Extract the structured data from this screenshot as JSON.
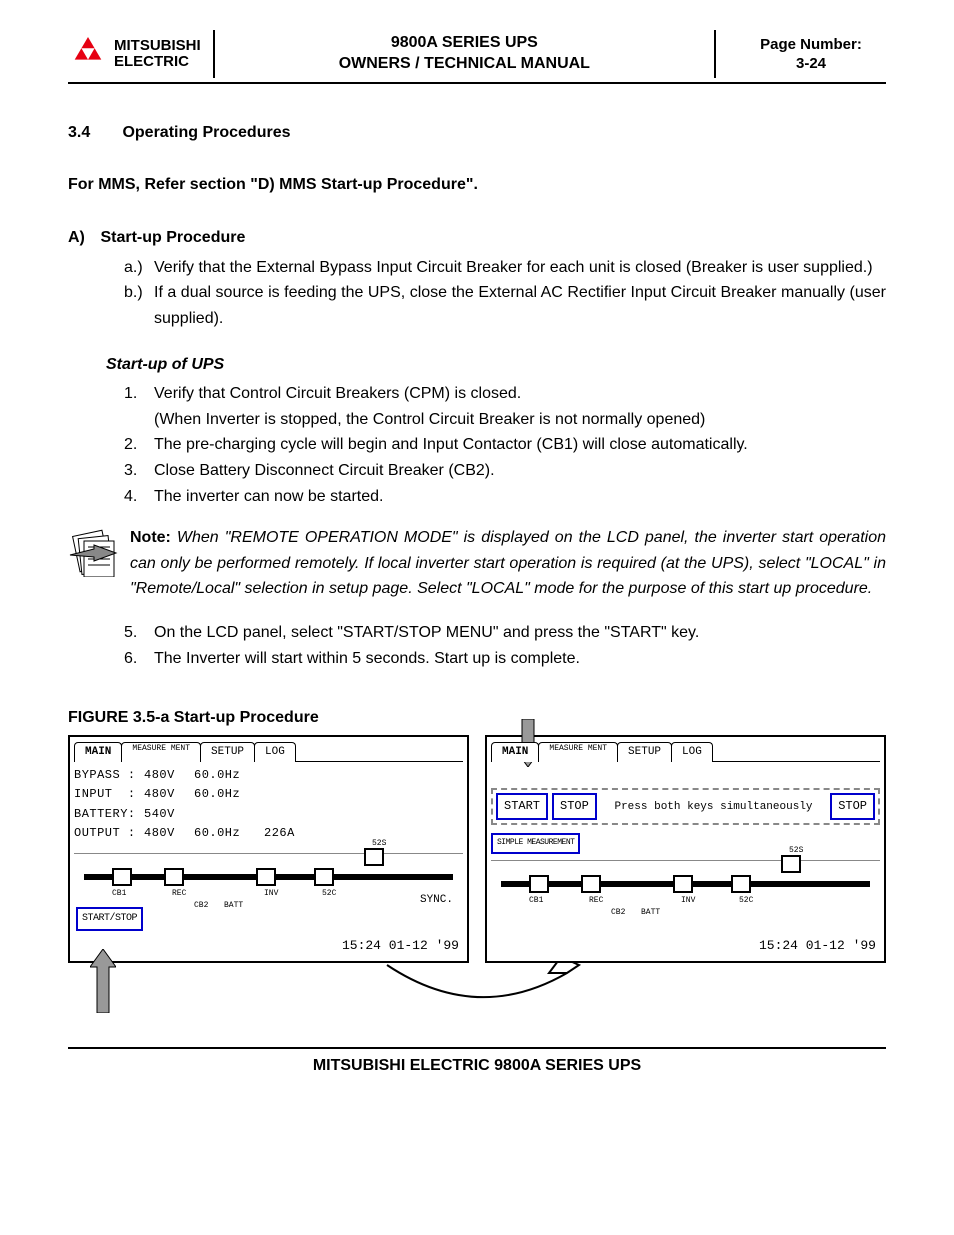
{
  "header": {
    "brand1": "MITSUBISHI",
    "brand2": "ELECTRIC",
    "title1": "9800A SERIES UPS",
    "title2": "OWNERS / TECHNICAL MANUAL",
    "page_label": "Page Number:",
    "page_num": "3-24"
  },
  "section": {
    "num": "3.4",
    "title": "Operating Procedures",
    "mms_ref": "For MMS, Refer section \"D) MMS Start-up Procedure\"."
  },
  "A": {
    "letter": "A)",
    "title": "Start-up Procedure",
    "items": [
      {
        "label": "a.)",
        "text": "Verify that the External Bypass Input Circuit Breaker for each unit is closed (Breaker is user supplied.)"
      },
      {
        "label": "b.)",
        "text": "If a dual source is feeding the UPS, close the External AC Rectifier Input Circuit Breaker manually (user supplied)."
      }
    ]
  },
  "startup": {
    "title": "Start-up of UPS",
    "items1": [
      {
        "label": "1.",
        "text": "Verify that Control Circuit Breakers (CPM) is closed."
      },
      {
        "label": "",
        "text": "(When Inverter is stopped, the Control Circuit Breaker is not normally opened)"
      },
      {
        "label": "2.",
        "text": "The pre-charging cycle will begin and Input Contactor (CB1) will close automatically."
      },
      {
        "label": "3.",
        "text": "Close Battery Disconnect Circuit Breaker (CB2)."
      },
      {
        "label": "4.",
        "text": "The inverter can now be started."
      }
    ],
    "items2": [
      {
        "label": "5.",
        "text": "On the LCD panel, select \"START/STOP MENU\" and press the \"START\" key."
      },
      {
        "label": "6.",
        "text": "The Inverter will start within 5 seconds. Start up is complete."
      }
    ]
  },
  "note": {
    "label": "Note:",
    "text": "When \"REMOTE OPERATION MODE\" is displayed on the LCD panel, the inverter start operation can only be performed remotely. If local inverter start operation is required (at the UPS), select \"LOCAL\" in \"Remote/Local\" selection in setup page. Select \"LOCAL\" mode for the purpose of this start up procedure."
  },
  "figure": {
    "title": "FIGURE 3.5-a   Start-up Procedure"
  },
  "lcd_tabs": [
    "MAIN",
    "MEASURE MENT",
    "SETUP",
    "LOG"
  ],
  "lcd1": {
    "rows": [
      [
        "BYPASS :",
        "480V",
        "60.0Hz",
        ""
      ],
      [
        "INPUT  :",
        "480V",
        "60.0Hz",
        ""
      ],
      [
        "BATTERY:",
        "540V",
        "",
        ""
      ],
      [
        "OUTPUT :",
        "480V",
        "60.0Hz",
        "226A"
      ]
    ],
    "ss_btn": "START/STOP",
    "sync": "SYNC.",
    "diag_labels": {
      "cb1": "CB1",
      "rec": "REC",
      "inv": "INV",
      "s2s": "52S",
      "s2c": "52C",
      "cb2": "CB2",
      "batt": "BATT"
    },
    "datetime": "15:24 01-12 '99"
  },
  "lcd2": {
    "start": "START",
    "stop": "STOP",
    "msg": "Press both keys simultaneously",
    "simple": "SIMPLE MEASUREMENT",
    "diag_labels": {
      "cb1": "CB1",
      "rec": "REC",
      "inv": "INV",
      "s2s": "52S",
      "s2c": "52C",
      "cb2": "CB2",
      "batt": "BATT"
    },
    "datetime": "15:24 01-12 '99"
  },
  "footer": "MITSUBISHI ELECTRIC 9800A SERIES UPS"
}
